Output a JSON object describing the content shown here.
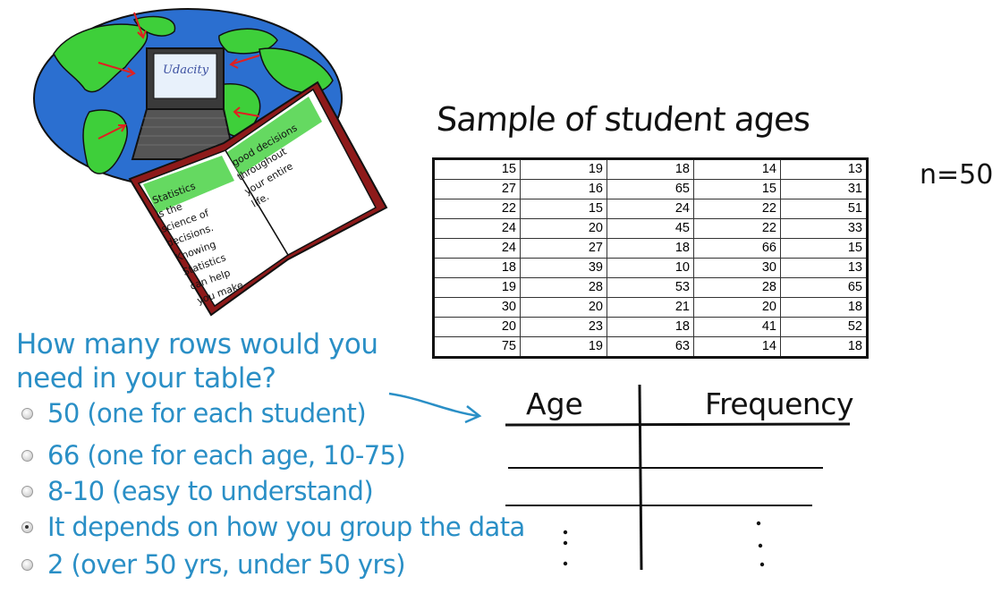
{
  "illustration": {
    "laptop_label": "Udacity",
    "book_left_page": [
      "Statistics",
      "is the",
      "science of",
      "decisions.",
      "Knowing",
      "Statistics",
      "can help",
      "you make"
    ],
    "book_right_page": [
      "good decisions",
      "throughout",
      "your entire",
      "life."
    ]
  },
  "table": {
    "title": "Sample of student ages",
    "sample_size": "n=50",
    "rows": [
      [
        "15",
        "19",
        "18",
        "14",
        "13"
      ],
      [
        "27",
        "16",
        "65",
        "15",
        "31"
      ],
      [
        "22",
        "15",
        "24",
        "22",
        "51"
      ],
      [
        "24",
        "20",
        "45",
        "22",
        "33"
      ],
      [
        "24",
        "27",
        "18",
        "66",
        "15"
      ],
      [
        "18",
        "39",
        "10",
        "30",
        "13"
      ],
      [
        "19",
        "28",
        "53",
        "28",
        "65"
      ],
      [
        "30",
        "20",
        "21",
        "20",
        "18"
      ],
      [
        "20",
        "23",
        "18",
        "41",
        "52"
      ],
      [
        "75",
        "19",
        "63",
        "14",
        "18"
      ]
    ]
  },
  "question": {
    "line1": "How many rows would you",
    "line2": "need in your table?",
    "options": [
      {
        "label": "50 (one for each student)",
        "selected": false
      },
      {
        "label": "66 (one for each age, 10-75)",
        "selected": false
      },
      {
        "label": "8-10 (easy to understand)",
        "selected": false
      },
      {
        "label": "It depends on how you group the data",
        "selected": true
      },
      {
        "label": "2 (over 50 yrs, under 50 yrs)",
        "selected": false
      }
    ]
  },
  "frequency_table": {
    "col1_header": "Age",
    "col2_header": "Frequency",
    "continuation": ":"
  },
  "colors": {
    "question_blue": "#2a8fc6",
    "ocean_blue": "#2b6fd0",
    "land_green": "#3ecf3a",
    "book_red": "#8e1a1a"
  }
}
